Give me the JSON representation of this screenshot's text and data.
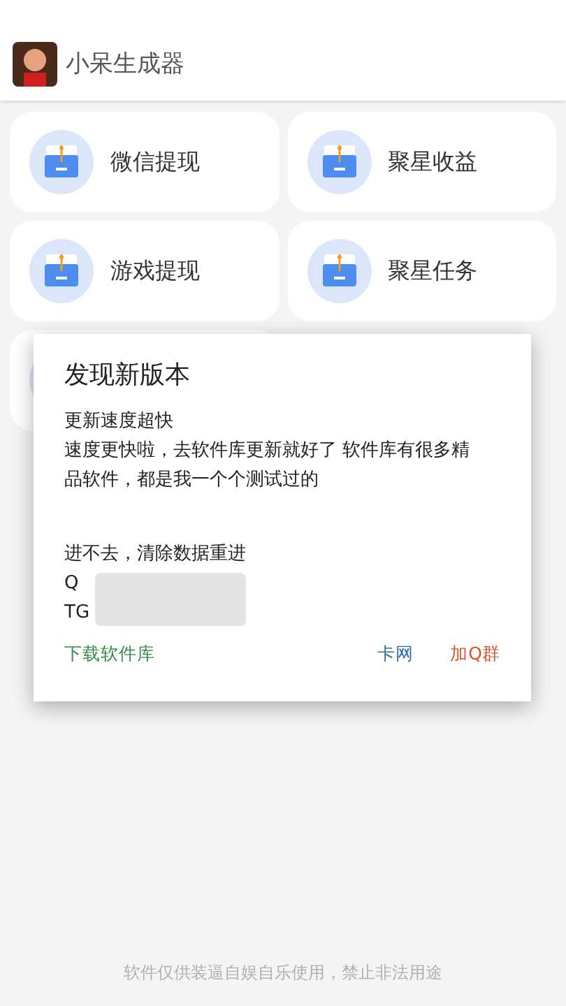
{
  "app_bar": {
    "title": "小呆生成器"
  },
  "menu_cards": [
    {
      "kind": "card",
      "label": "微信提现"
    },
    {
      "kind": "card",
      "label": "聚星收益"
    },
    {
      "kind": "card",
      "label": "游戏提现"
    },
    {
      "kind": "card",
      "label": "聚星任务"
    },
    {
      "kind": "covered"
    }
  ],
  "dialog": {
    "title": "发现新版本",
    "lines": [
      "更新速度超快",
      "速度更快啦，去软件库更新就好了 软件库有很多精品软件，都是我一个个测试过的"
    ],
    "lines_2": [
      "进不去，清除数据重进",
      "Q",
      "TG"
    ],
    "buttons": [
      {
        "label": "下载软件库",
        "color": "#3a8a4a"
      },
      {
        "label": "卡网",
        "color": "#2f6eaa"
      },
      {
        "label": "加Q群",
        "color": "#d9542c"
      }
    ]
  },
  "footer": "软件仅供装逼自娱自乐使用，禁止非法用途"
}
